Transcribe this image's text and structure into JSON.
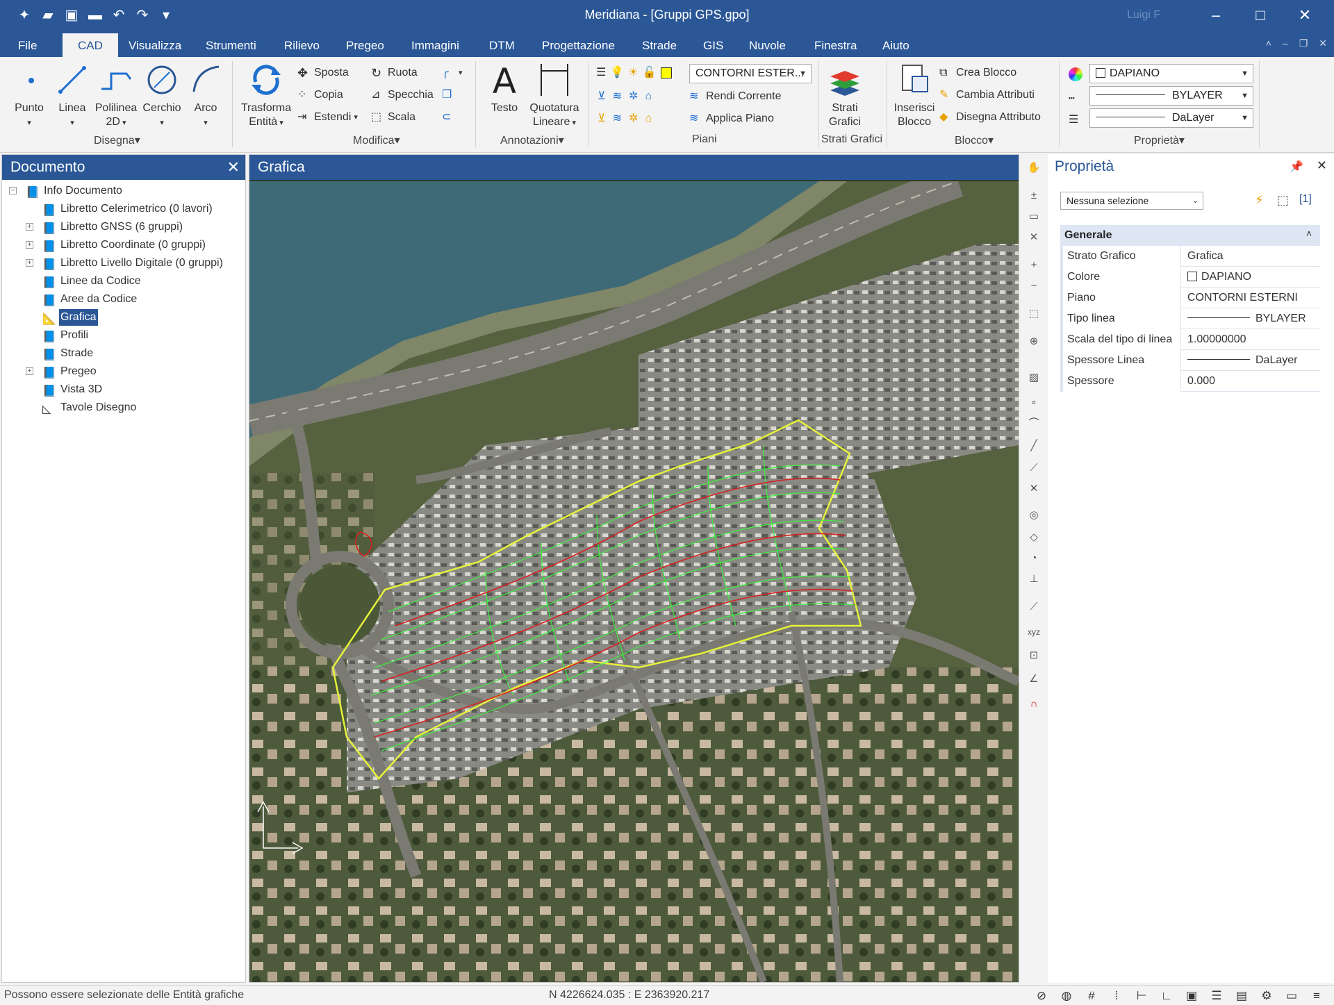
{
  "window": {
    "title": "Meridiana - [Gruppi GPS.gpo]",
    "user": "Luigi F"
  },
  "menu": [
    "File",
    "CAD",
    "Visualizza",
    "Strumenti",
    "Rilievo",
    "Pregeo",
    "Immagini",
    "DTM",
    "Progettazione",
    "Strade",
    "GIS",
    "Nuvole",
    "Finestra",
    "Aiuto"
  ],
  "ribbon": {
    "disegna": {
      "label": "Disegna",
      "punto": "Punto",
      "linea": "Linea",
      "polilinea": "Polilinea",
      "polilinea2": "2D",
      "cerchio": "Cerchio",
      "arco": "Arco"
    },
    "modifica": {
      "label": "Modifica",
      "trasforma": "Trasforma",
      "trasforma2": "Entità",
      "sposta": "Sposta",
      "copia": "Copia",
      "estendi": "Estendi",
      "ruota": "Ruota",
      "specchia": "Specchia",
      "scala": "Scala"
    },
    "annotazioni": {
      "label": "Annotazioni",
      "testo": "Testo",
      "quotatura": "Quotatura",
      "quotatura2": "Lineare"
    },
    "piani": {
      "label": "Piani",
      "current_layer": "CONTORNI ESTER...",
      "rendi_corrente": "Rendi Corrente",
      "applica_piano": "Applica Piano"
    },
    "strati": {
      "label": "Strati Grafici",
      "btn": "Strati",
      "btn2": "Grafici"
    },
    "blocco": {
      "label": "Blocco",
      "inserisci": "Inserisci",
      "inserisci2": "Blocco",
      "crea": "Crea Blocco",
      "cambia": "Cambia Attributi",
      "disegna_attr": "Disegna Attributo"
    },
    "proprieta": {
      "label": "Proprietà",
      "color": "DAPIANO",
      "linetype": "BYLAYER",
      "lineweight": "DaLayer"
    }
  },
  "document_panel": {
    "title": "Documento",
    "tree": [
      {
        "label": "Info Documento",
        "expander": "−"
      },
      {
        "label": "Libretto Celerimetrico (0 lavori)",
        "expander": ""
      },
      {
        "label": "Libretto GNSS (6 gruppi)",
        "expander": "+"
      },
      {
        "label": "Libretto Coordinate (0 gruppi)",
        "expander": "+"
      },
      {
        "label": "Libretto Livello Digitale (0 gruppi)",
        "expander": "+"
      },
      {
        "label": "Linee da Codice",
        "expander": ""
      },
      {
        "label": "Aree da Codice",
        "expander": ""
      },
      {
        "label": "Grafica",
        "expander": "",
        "selected": true
      },
      {
        "label": "Profili",
        "expander": ""
      },
      {
        "label": "Strade",
        "expander": ""
      },
      {
        "label": "Pregeo",
        "expander": "+"
      },
      {
        "label": "Vista 3D",
        "expander": ""
      },
      {
        "label": "Tavole Disegno",
        "expander": ""
      }
    ]
  },
  "graphics_panel": {
    "title": "Grafica"
  },
  "properties_panel": {
    "title": "Proprietà",
    "selection": "Nessuna selezione",
    "section": "Generale",
    "rows": [
      {
        "key": "Strato Grafico",
        "value": "Grafica"
      },
      {
        "key": "Colore",
        "value": "DAPIANO"
      },
      {
        "key": "Piano",
        "value": "CONTORNI ESTERNI"
      },
      {
        "key": "Tipo linea",
        "value": "BYLAYER"
      },
      {
        "key": "Scala del tipo di linea",
        "value": "1.00000000"
      },
      {
        "key": "Spessore Linea",
        "value": "DaLayer"
      },
      {
        "key": "Spessore",
        "value": "0.000"
      }
    ]
  },
  "status": {
    "message": "Possono essere selezionate delle Entità grafiche",
    "coords": "N 4226624.035 : E 2363920.217"
  },
  "colors": {
    "accent": "#2b5797",
    "contour_green": "#3cf23c",
    "contour_red": "#d82020",
    "boundary_yellow": "#e6f23a"
  }
}
